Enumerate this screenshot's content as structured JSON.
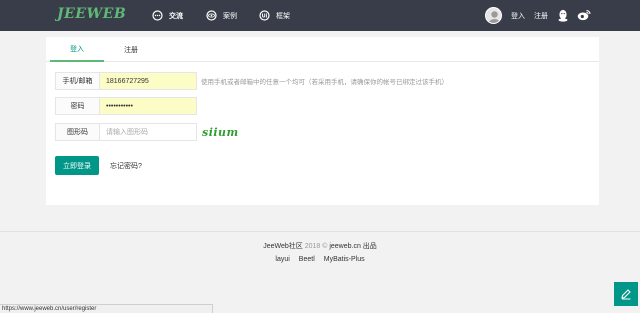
{
  "header": {
    "logo": "JEEWEB",
    "nav": [
      {
        "label": "交流",
        "icon": "chat-icon",
        "active": true
      },
      {
        "label": "案例",
        "icon": "eye-icon",
        "active": false
      },
      {
        "label": "框架",
        "icon": "ui-icon",
        "active": false
      }
    ],
    "login_link": "登入",
    "register_link": "注册"
  },
  "tabs": [
    {
      "label": "登入",
      "active": true
    },
    {
      "label": "注册",
      "active": false
    }
  ],
  "form": {
    "account": {
      "label": "手机/邮箱",
      "value": "18166727295"
    },
    "account_hint": "使用手机或者邮箱中的任意一个均可（若采用手机，请确保你的帐号已绑定过该手机）",
    "password": {
      "label": "密码",
      "value": "•••••••••••"
    },
    "captcha": {
      "label": "图形码",
      "placeholder": "请输入图形码",
      "image_text": "siium"
    },
    "submit_label": "立即登录",
    "forgot_label": "忘记密码?"
  },
  "footer": {
    "site": "JeeWeb社区",
    "year": "2018 ©",
    "domain": "jeeweb.cn 出品",
    "links": [
      "layui",
      "Beetl",
      "MyBatis-Plus"
    ]
  },
  "status_bar": {
    "url": "https://www.jeeweb.cn/user/register"
  },
  "colors": {
    "header_bg": "#393d49",
    "accent": "#009688",
    "logo": "#5fb878",
    "autofill": "#fcfcc6"
  }
}
